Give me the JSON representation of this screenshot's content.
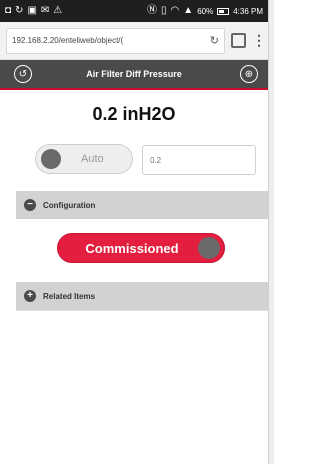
{
  "statusbar": {
    "left_icons": [
      "notification-icon",
      "sync-icon",
      "gallery-icon",
      "mail-icon",
      "warning-icon"
    ],
    "right_icons": [
      "nfc-icon",
      "vibrate-icon",
      "wifi-icon",
      "signal-icon",
      "battery-icon"
    ],
    "battery": "60%",
    "time": "4:36 PM"
  },
  "browser": {
    "url": "192.168.2.20/enteliweb/object/(",
    "reload_icon": "reload-icon",
    "tabs_count": "",
    "menu_icon": "overflow-menu-icon"
  },
  "header": {
    "title": "Air Filter Diff Pressure",
    "back_icon": "back-icon",
    "globe_icon": "globe-icon"
  },
  "reading": {
    "value": "0.2 inH2O"
  },
  "control": {
    "auto_label": "Auto",
    "auto_on": false,
    "input_placeholder": "0.2"
  },
  "sections": {
    "configuration": {
      "label": "Configuration",
      "icon": "collapse-icon",
      "toggle_label": "Commissioned",
      "toggle_on": true,
      "accent": "#e41e3f"
    },
    "related": {
      "label": "Related Items",
      "icon": "expand-icon"
    }
  }
}
